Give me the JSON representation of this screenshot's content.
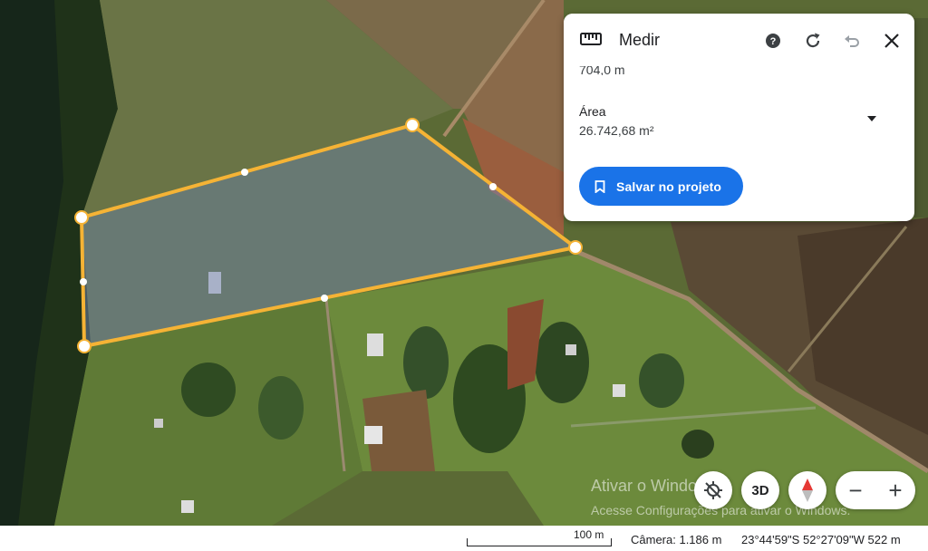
{
  "panel": {
    "title": "Medir",
    "partial_value": "704,0 m",
    "area_label": "Área",
    "area_value": "26.742,68 m²",
    "save_label": "Salvar no projeto"
  },
  "controls": {
    "three_d_label": "3D",
    "zoom_out": "−",
    "zoom_in": "+"
  },
  "watermark": {
    "line1": "Ativar o Windows",
    "line2": "Acesse Configurações para ativar o Windows."
  },
  "status": {
    "scale": "100 m",
    "camera": "Câmera: 1.186 m",
    "coordinates": "23°44'59\"S 52°27'09\"W  522 m"
  },
  "colors": {
    "accent": "#1a73e8",
    "polygon_stroke": "#f5b335"
  }
}
